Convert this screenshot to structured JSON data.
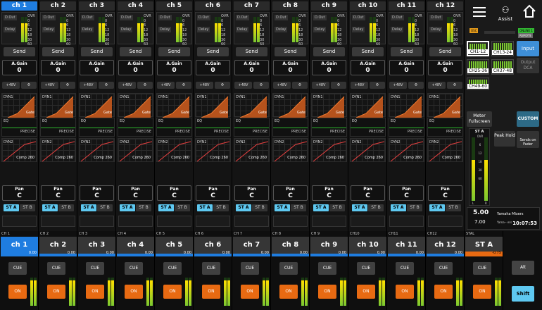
{
  "channels": [
    {
      "name": "ch 1",
      "selected": true
    },
    {
      "name": "ch 2"
    },
    {
      "name": "ch 3"
    },
    {
      "name": "ch 4"
    },
    {
      "name": "ch 5"
    },
    {
      "name": "ch 6"
    },
    {
      "name": "ch 7"
    },
    {
      "name": "ch 8"
    },
    {
      "name": "ch 9"
    },
    {
      "name": "ch 10"
    },
    {
      "name": "ch 11"
    },
    {
      "name": "ch 12"
    }
  ],
  "channel_common": {
    "dout_label": "D.Out",
    "delay_label": "Delay",
    "meter_scale": [
      "OVR",
      "0",
      "6",
      "12",
      "18",
      "30",
      "60"
    ],
    "send_label": "Send",
    "gain_label": "A.Gain",
    "gain_value": "0",
    "phantom_label": "+48V",
    "phase_label": "Φ",
    "dyn1_label": "DYN1",
    "dyn1_type": "Gate",
    "eq_label": "EQ",
    "eq_type": "PRECISE",
    "dyn2_label": "DYN2",
    "dyn2_type": "Comp 260",
    "pan_label": "Pan",
    "pan_value": "C",
    "sta_label": "ST A",
    "stb_label": "ST B"
  },
  "right_panel": {
    "assist_label": "Assist",
    "osc_badge": "OSC",
    "online_badge": "ONLINE 1",
    "remote_badge": "REMOTE",
    "banks": [
      "CH1-12",
      "CH13-24",
      "CH25-36",
      "CH37-48",
      "CH49-60"
    ],
    "input_label": "Input",
    "output_dca_label": "Output DCA",
    "meter_fullscreen_label": "Meter Fullscreen",
    "custom_label": "CUSTOM",
    "peak_hold_label": "Peak Hold",
    "sends_on_fader_label": "Sends on Fader",
    "st_meter_label": "ST A",
    "st_scale": [
      "OVR",
      "6",
      "12",
      "18",
      "30",
      "60"
    ],
    "st_l": "L",
    "st_r": "R",
    "scene_number": "5.00",
    "scene_sub": "7.00",
    "scene_title": "Yamaha Mixers",
    "scene_comment": "Yama-- ers",
    "time": "10:07:53"
  },
  "strips": [
    {
      "id": "CH 1",
      "name": "ch 1",
      "level": "0.00",
      "selected": true
    },
    {
      "id": "CH 2",
      "name": "ch 2",
      "level": "0.00"
    },
    {
      "id": "CH 3",
      "name": "ch 3",
      "level": "0.00"
    },
    {
      "id": "CH 4",
      "name": "ch 4",
      "level": "0.00"
    },
    {
      "id": "CH 5",
      "name": "ch 5",
      "level": "0.00"
    },
    {
      "id": "CH 6",
      "name": "ch 6",
      "level": "0.00"
    },
    {
      "id": "CH 7",
      "name": "ch 7",
      "level": "0.00"
    },
    {
      "id": "CH 8",
      "name": "ch 8",
      "level": "0.00"
    },
    {
      "id": "CH 9",
      "name": "ch 9",
      "level": "0.00"
    },
    {
      "id": "CH10",
      "name": "ch 10",
      "level": "0.00"
    },
    {
      "id": "CH11",
      "name": "ch 11",
      "level": "0.00"
    },
    {
      "id": "CH12",
      "name": "ch 12",
      "level": "0.00"
    },
    {
      "id": "STAL",
      "name": "ST A",
      "level": "-0.75"
    }
  ],
  "strip_common": {
    "cue_label": "CUE",
    "on_label": "ON"
  },
  "shift_col": {
    "alt_label": "Alt",
    "shift_label": "Shift"
  },
  "colors": {
    "accent": "#1f7de0",
    "on": "#e86a12",
    "meter": "#7ac830",
    "st": "#5ec8f0"
  },
  "meter_levels": {
    "channel_fraction": 0.75,
    "strip_fraction": 0.9,
    "st_fraction": 0.65
  }
}
